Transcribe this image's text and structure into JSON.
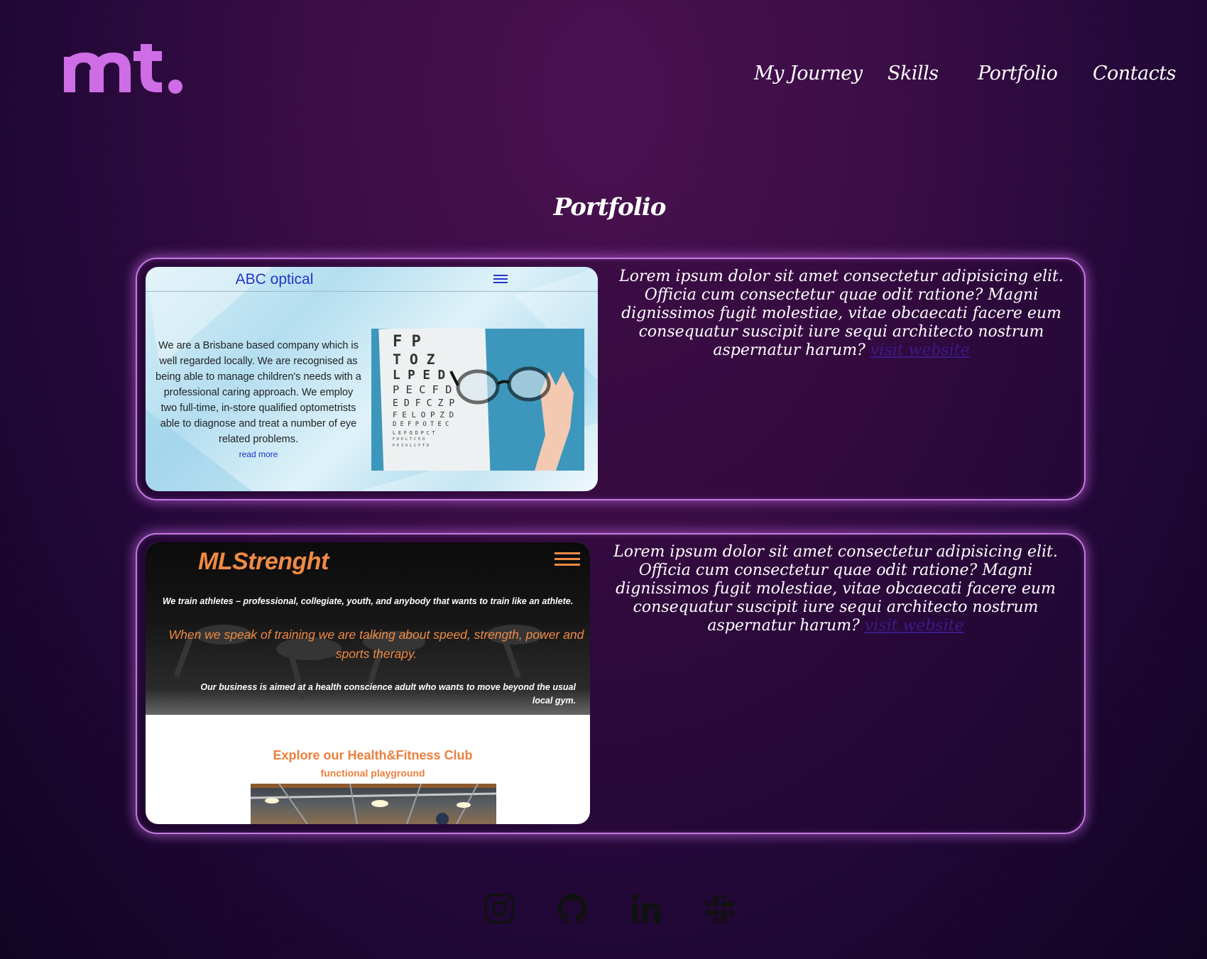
{
  "header": {
    "logo_text": "mt.",
    "nav": [
      "My Journey",
      "Skills",
      "Portfolio",
      "Contacts"
    ]
  },
  "page_title": "Portfolio",
  "projects": [
    {
      "description": "Lorem ipsum dolor sit amet consectetur adipisicing elit. Officia cum consectetur quae odit ratione? Magni dignissimos fugit molestiae, vitae obcaecati facere eum consequatur suscipit iure sequi architecto nostrum aspernatur harum?",
      "link_label": "visit website",
      "screenshot": {
        "title": "ABC optical",
        "text": "We are a Brisbane based company which is well regarded locally. We are recognised as being able to manage children's needs with a professional caring approach. We employ two full-time, in-store qualified optometrists able to diagnose and treat a number of eye related problems.",
        "read_more": "read more",
        "chart_rows": [
          "F P",
          "T O Z",
          "L P E D",
          "P E C F D",
          "E D F C Z P",
          "F E L O P Z D",
          "D E F P O T E C",
          "L E F O D P C T",
          "F D P L T C E O",
          "P E Z O L C F T D"
        ]
      }
    },
    {
      "description": "Lorem ipsum dolor sit amet consectetur adipisicing elit. Officia cum consectetur quae odit ratione? Magni dignissimos fugit molestiae, vitae obcaecati facere eum consequatur suscipit iure sequi architecto nostrum aspernatur harum?",
      "link_label": "visit website",
      "screenshot": {
        "logo": "MLStrenght",
        "line1": "We train athletes – professional, collegiate, youth, and anybody that wants to train like an athlete.",
        "line2": "When we speak of training we are talking about speed, strength, power and sports therapy.",
        "line3": "Our business is aimed at a health conscience adult who wants to move beyond the usual local gym.",
        "heading": "Explore our Health&Fitness Club",
        "subheading": "functional playground"
      }
    }
  ],
  "socials": [
    "instagram",
    "github",
    "linkedin",
    "slack"
  ],
  "colors": {
    "logo": "#cf6de6",
    "card_border": "#c57ae0",
    "link": "#3b1b8a",
    "abc_blue": "#1f35c9",
    "ml_orange": "#f08a45"
  }
}
